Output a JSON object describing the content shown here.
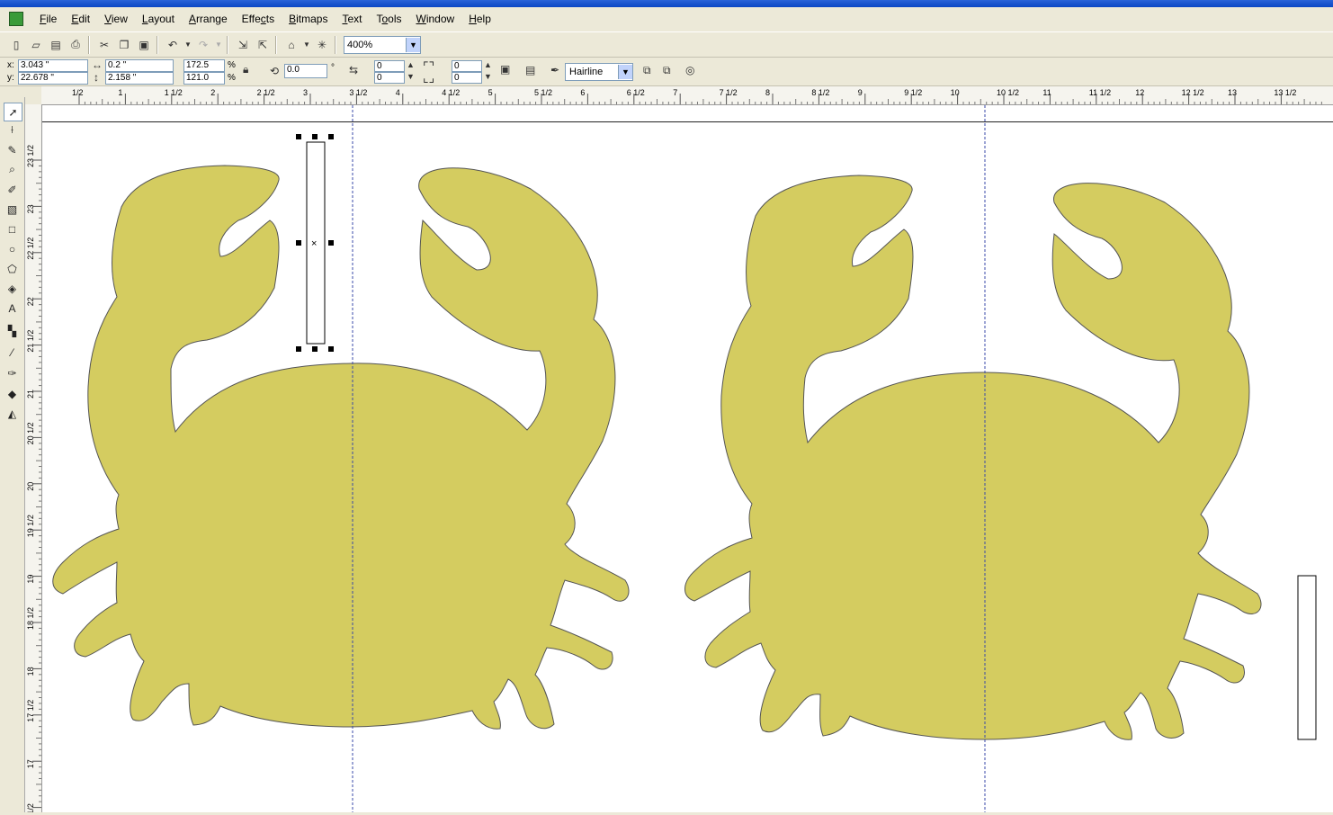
{
  "menu": {
    "items": [
      "File",
      "Edit",
      "View",
      "Layout",
      "Arrange",
      "Effects",
      "Bitmaps",
      "Text",
      "Tools",
      "Window",
      "Help"
    ],
    "underline": [
      "F",
      "E",
      "V",
      "L",
      "A",
      "c",
      "B",
      "T",
      "o",
      "W",
      "H"
    ]
  },
  "toolbar": {
    "zoom_value": "400%",
    "icons": [
      "new-icon",
      "open-icon",
      "save-icon",
      "print-icon",
      "cut-icon",
      "copy-icon",
      "paste-icon",
      "undo-icon",
      "redo-icon",
      "import-icon",
      "export-icon",
      "application-launcher-icon",
      "corel-online-icon"
    ]
  },
  "property_bar": {
    "x_label": "x:",
    "x_value": "3.043 \"",
    "y_label": "y:",
    "y_value": "22.678 \"",
    "width_value": "0.2 \"",
    "height_value": "2.158 \"",
    "scale_x": "172.5",
    "scale_y": "121.0",
    "percent": "%",
    "rotation": "0.0",
    "degree": "°",
    "corner_1": "0",
    "corner_2": "0",
    "corner_3": "0",
    "corner_4": "0",
    "outline_width": "Hairline"
  },
  "ruler": {
    "top_labels": [
      "1/2",
      "1",
      "1 1/2",
      "2",
      "2 1/2",
      "3",
      "3 1/2",
      "4",
      "4 1/2",
      "5",
      "5 1/2",
      "6",
      "6 1/2",
      "7",
      "7 1/2",
      "8",
      "8 1/2",
      "9",
      "9 1/2",
      "10",
      "10 1/2",
      "11",
      "11 1/2",
      "12",
      "12 1/2",
      "13",
      "13 1/2"
    ],
    "left_labels": [
      "23 1/2",
      "23",
      "22 1/2",
      "22",
      "21 1/2",
      "21",
      "20 1/2",
      "20",
      "19 1/2",
      "19",
      "18 1/2",
      "18",
      "17 1/2",
      "17",
      "1/2"
    ]
  },
  "toolbox": {
    "tools": [
      "pick-tool",
      "shape-tool",
      "crop-tool",
      "zoom-tool",
      "freehand-tool",
      "smart-fill-tool",
      "rectangle-tool",
      "ellipse-tool",
      "polygon-tool",
      "basic-shapes-tool",
      "text-tool",
      "interactive-blend-tool",
      "eyedropper-tool",
      "outline-tool",
      "fill-tool",
      "interactive-fill-tool"
    ]
  },
  "colors": {
    "crab_fill": "#d4cc60",
    "crab_outline": "#555",
    "guide": "#3a4aa8"
  }
}
